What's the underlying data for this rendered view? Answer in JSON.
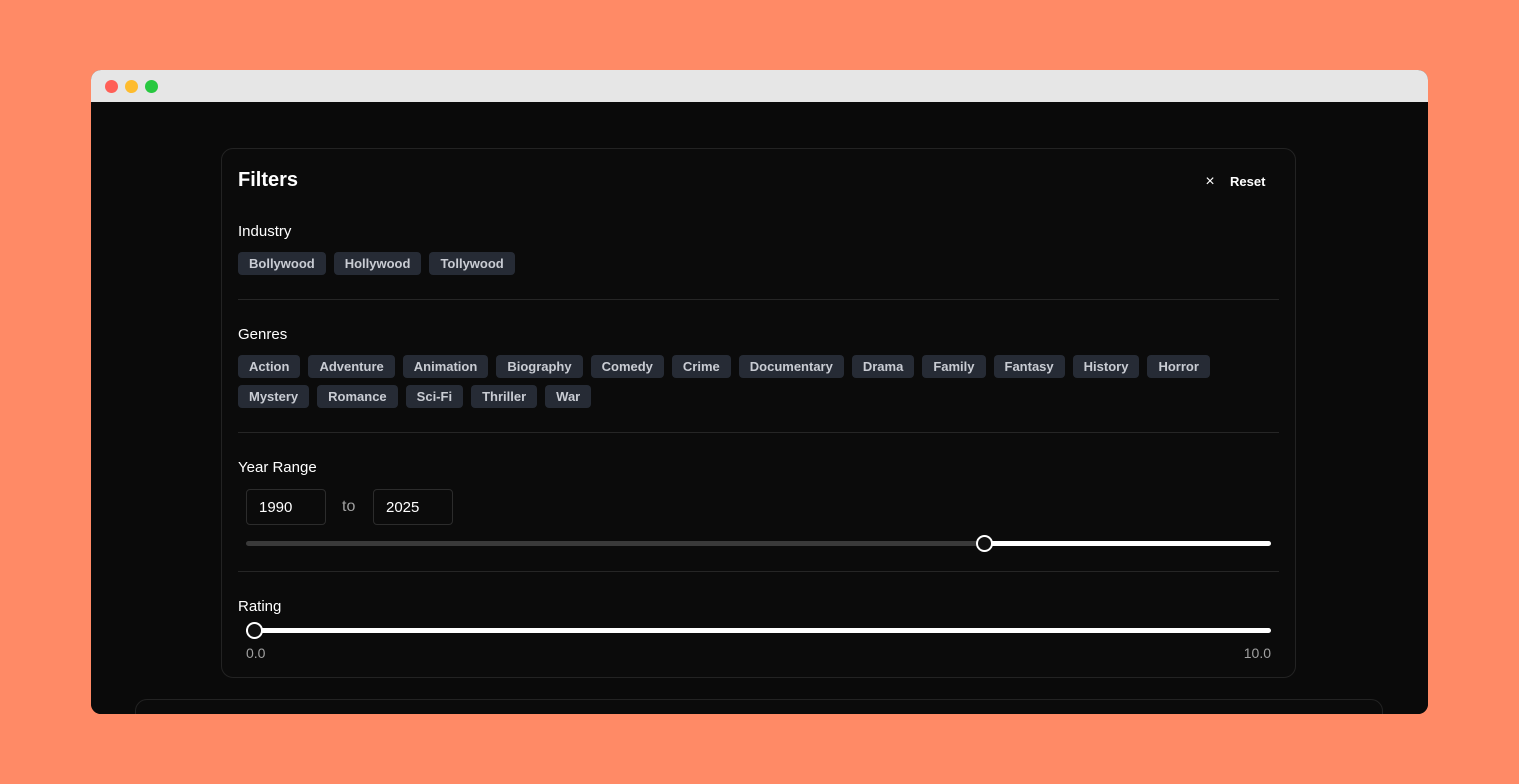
{
  "window": {
    "controls": [
      "close",
      "minimize",
      "maximize"
    ]
  },
  "filters": {
    "title": "Filters",
    "close_icon": "×",
    "reset_label": "Reset",
    "industry": {
      "label": "Industry",
      "options": [
        "Bollywood",
        "Hollywood",
        "Tollywood"
      ]
    },
    "genres": {
      "label": "Genres",
      "options": [
        "Action",
        "Adventure",
        "Animation",
        "Biography",
        "Comedy",
        "Crime",
        "Documentary",
        "Drama",
        "Family",
        "Fantasy",
        "History",
        "Horror",
        "Mystery",
        "Romance",
        "Sci-Fi",
        "Thriller",
        "War"
      ]
    },
    "year_range": {
      "label": "Year Range",
      "from": "1990",
      "to_label": "to",
      "to": "2025",
      "slider_min_year": 1900,
      "slider_max_year": 2025
    },
    "rating": {
      "label": "Rating",
      "min_label": "0.0",
      "max_label": "10.0",
      "value": 0.0,
      "max": 10.0
    }
  },
  "colors": {
    "background": "#ff8a66",
    "panel": "#0b0b0b",
    "chip": "#262b35",
    "accent": "#ffffff"
  }
}
